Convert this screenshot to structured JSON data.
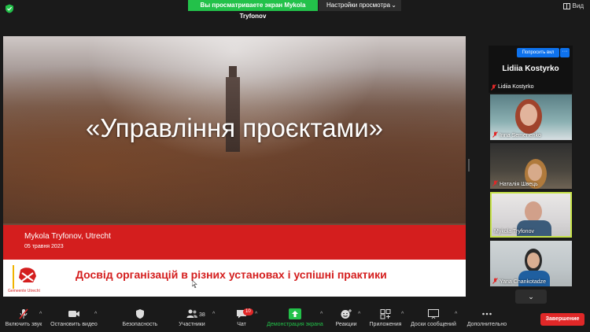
{
  "top_bar": {
    "sharing_notice": "Вы просматриваете экран Mykola Tryfonov",
    "view_options_label": "Настройки просмотра",
    "view_label": "Вид"
  },
  "slide": {
    "title": "«Управління проєктами»",
    "presenter": "Mykola Tryfonov, Utrecht",
    "date": "05 травня 2023",
    "subtitle": "Досвід організацій в різних установах і успішні практики",
    "logo_text": "Gemeente Utrecht"
  },
  "sidebar": {
    "raise_hand_label": "Попросить вкл",
    "more_label": "···",
    "active_speaker_big": "Lidiia Kostyrko",
    "active_speaker_small": "Lidiia Kostyrko",
    "participants": [
      {
        "name": "Inna Semenenko"
      },
      {
        "name": "Наталія Швець"
      },
      {
        "name": "Mykola Tryfonov"
      },
      {
        "name": "Yana Chankotadze"
      }
    ]
  },
  "toolbar": {
    "unmute": "Включить звук",
    "stop_video": "Остановить видео",
    "security": "Безопасность",
    "participants": "Участники",
    "participants_count": "38",
    "chat": "Чат",
    "chat_badge": "10",
    "share_screen": "Демонстрация экрана",
    "reactions": "Реакции",
    "apps": "Приложения",
    "whiteboards": "Доски сообщений",
    "more": "Дополнительно",
    "end": "Завершение"
  },
  "colors": {
    "accent_green": "#23c14a",
    "end_red": "#e02828",
    "slide_red": "#d41e1e",
    "zoom_blue": "#0e72ed",
    "active_border": "#c7e34a"
  }
}
